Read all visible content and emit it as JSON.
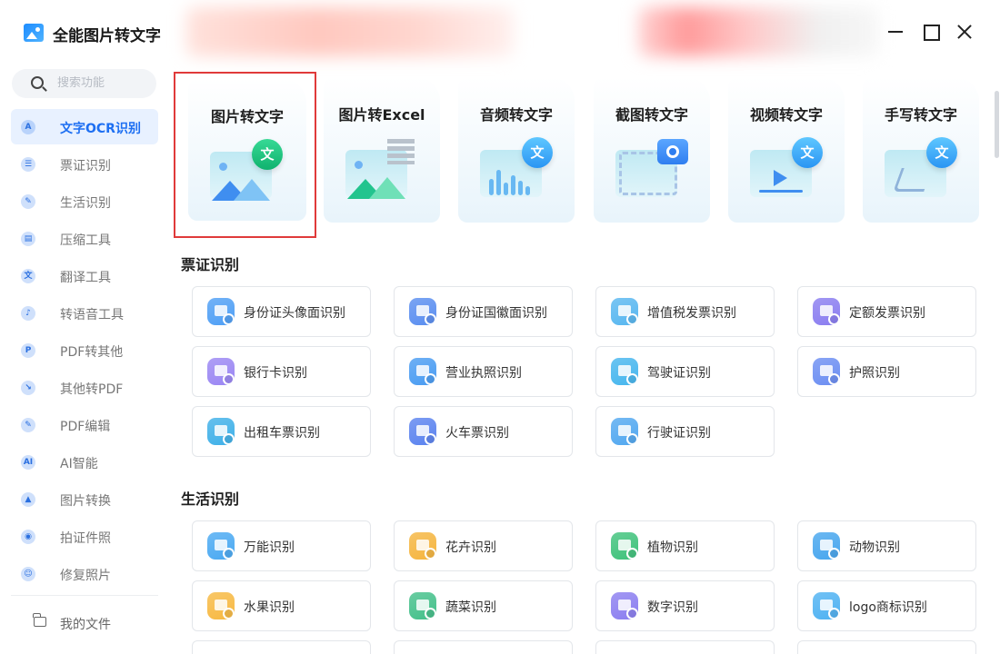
{
  "app": {
    "title": "全能图片转文字"
  },
  "sidebar": {
    "search_placeholder": "搜索功能",
    "items": [
      {
        "label": "文字OCR识别",
        "icon": "A",
        "active": true
      },
      {
        "label": "票证识别",
        "icon": "☰"
      },
      {
        "label": "生活识别",
        "icon": "✎"
      },
      {
        "label": "压缩工具",
        "icon": "▤"
      },
      {
        "label": "翻译工具",
        "icon": "文"
      },
      {
        "label": "转语音工具",
        "icon": "♪"
      },
      {
        "label": "PDF转其他",
        "icon": "P"
      },
      {
        "label": "其他转PDF",
        "icon": "↘"
      },
      {
        "label": "PDF编辑",
        "icon": "✎"
      },
      {
        "label": "AI智能",
        "icon": "AI"
      },
      {
        "label": "图片转换",
        "icon": "▲"
      },
      {
        "label": "拍证件照",
        "icon": "◉"
      },
      {
        "label": "修复照片",
        "icon": "☺"
      }
    ],
    "files_label": "我的文件"
  },
  "features": [
    {
      "title": "图片转文字",
      "art": "image-text"
    },
    {
      "title": "图片转Excel",
      "art": "image-excel"
    },
    {
      "title": "音频转文字",
      "art": "audio-text"
    },
    {
      "title": "截图转文字",
      "art": "screenshot-text"
    },
    {
      "title": "视频转文字",
      "art": "video-text"
    },
    {
      "title": "手写转文字",
      "art": "handwriting-text"
    }
  ],
  "wen_glyph": "文",
  "sections": {
    "tickets": {
      "title": "票证识别",
      "items": [
        {
          "label": "身份证头像面识别",
          "color": "#4f9ff5"
        },
        {
          "label": "身份证国徽面识别",
          "color": "#5a8ef0"
        },
        {
          "label": "增值税发票识别",
          "color": "#58b7f0"
        },
        {
          "label": "定额发票识别",
          "color": "#8a7df0"
        },
        {
          "label": "银行卡识别",
          "color": "#9a86f3"
        },
        {
          "label": "营业执照识别",
          "color": "#4a9cf2"
        },
        {
          "label": "驾驶证识别",
          "color": "#46b6ee"
        },
        {
          "label": "护照识别",
          "color": "#6c8ef2"
        },
        {
          "label": "出租车票识别",
          "color": "#3fb0e8"
        },
        {
          "label": "火车票识别",
          "color": "#5b83ef"
        },
        {
          "label": "行驶证识别",
          "color": "#52a8f0"
        }
      ]
    },
    "life": {
      "title": "生活识别",
      "items": [
        {
          "label": "万能识别",
          "color": "#4aa9f2"
        },
        {
          "label": "花卉识别",
          "color": "#f5b53f"
        },
        {
          "label": "植物识别",
          "color": "#3fc27b"
        },
        {
          "label": "动物识别",
          "color": "#47a6ee"
        },
        {
          "label": "水果识别",
          "color": "#f7b942"
        },
        {
          "label": "蔬菜识别",
          "color": "#44c08a"
        },
        {
          "label": "数字识别",
          "color": "#8b7ef0"
        },
        {
          "label": "logo商标识别",
          "color": "#4fb2f2"
        }
      ]
    }
  }
}
